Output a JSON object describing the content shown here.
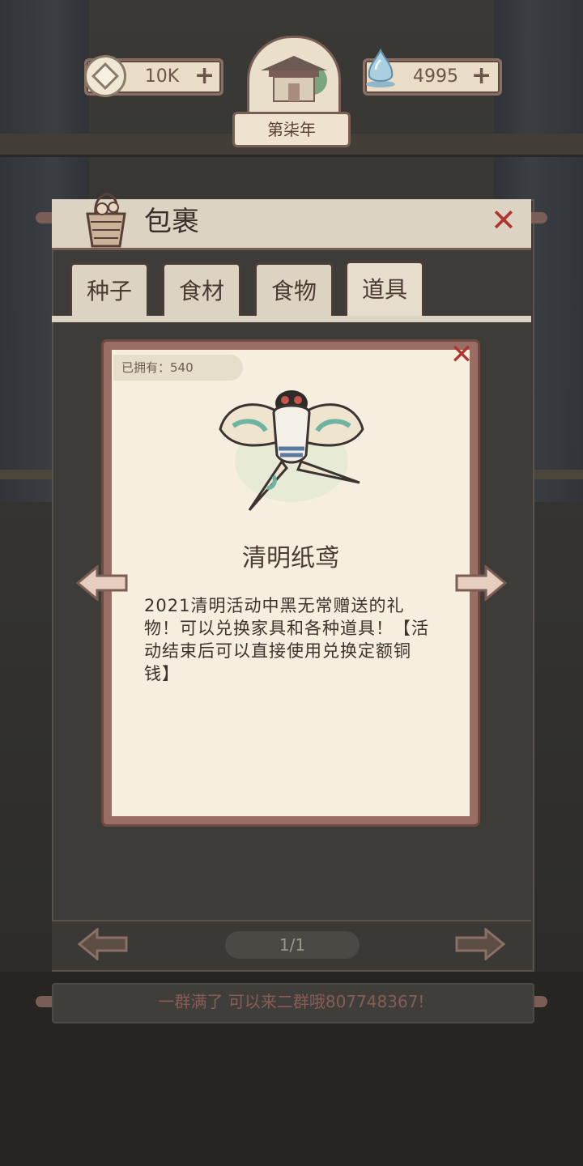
{
  "top_bar": {
    "coins_value": "10K",
    "jade_value": "4995",
    "plus_symbol": "+",
    "year_label": "第柒年"
  },
  "inventory": {
    "title": "包裹",
    "tabs": [
      {
        "label": "种子",
        "active": false
      },
      {
        "label": "食材",
        "active": false
      },
      {
        "label": "食物",
        "active": false
      },
      {
        "label": "道具",
        "active": true
      }
    ],
    "page_indicator": "1/1",
    "footer_message": "一群满了 可以来二群哦807748367!"
  },
  "item_detail": {
    "owned_label": "已拥有：540",
    "name": "清明纸鸢",
    "description": "2021清明活动中黑无常赠送的礼物！可以兑换家具和各种道具！【活动结束后可以直接使用兑换定额铜钱】"
  },
  "icons": {
    "coin": "copper-coin-icon",
    "jade": "water-drop-icon",
    "basket": "basket-icon",
    "close": "close-icon",
    "kite": "swallow-kite-icon",
    "arrow_left": "arrow-left-icon",
    "arrow_right": "arrow-right-icon"
  },
  "colors": {
    "accent_red": "#b0352f",
    "parchment": "#f6efdf",
    "frame": "#9a6f63"
  }
}
